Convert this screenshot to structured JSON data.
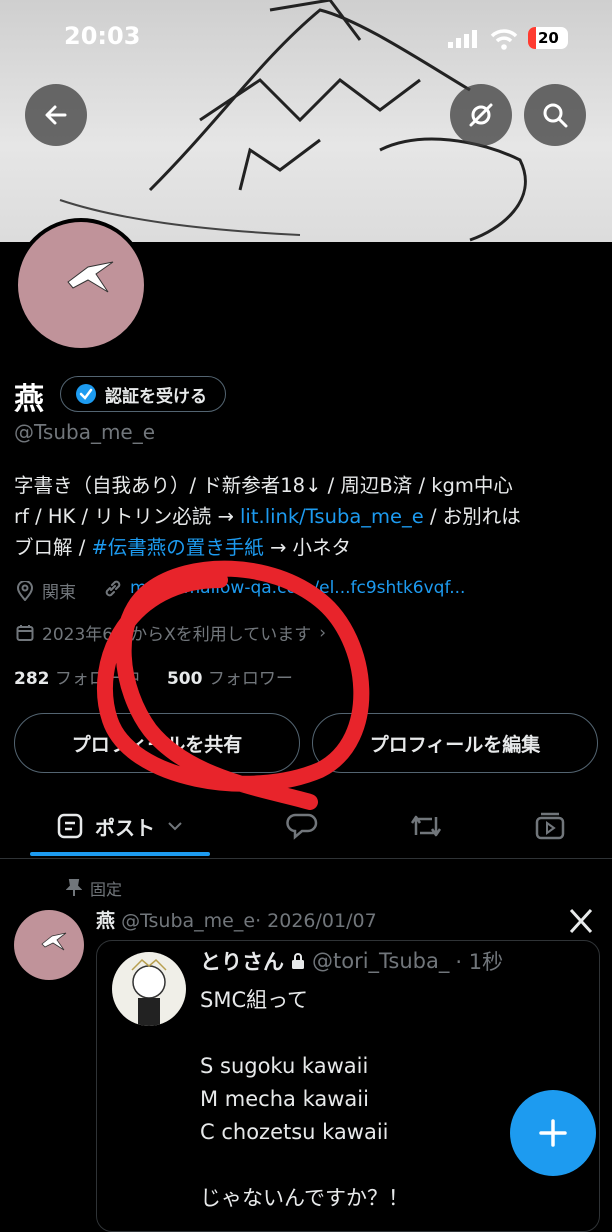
{
  "status_bar": {
    "time": "20:03",
    "battery": "20"
  },
  "profile": {
    "name": "燕",
    "verify_label": "認証を受ける",
    "handle": "@Tsuba_me_e",
    "bio_text_1": "字書き（自我あり）/ ド新参者18↓ / 周辺B済 / kgm中心",
    "bio_text_2": "rf / HK / リトリン必読 → ",
    "bio_link": "lit.link/Tsuba_me_e",
    "bio_text_3": " / お別れは",
    "bio_text_4": "ブロ解 / ",
    "bio_hashtag": "#伝書燕の置き手紙",
    "bio_text_5": " → 小ネタ",
    "location": "関東",
    "website": "marshmallow-qa.com/el...fc9shtk6vqf...",
    "joined": "2023年6月からXを利用しています",
    "following_count": "282",
    "following_label": "フォロー中",
    "followers_count": "500",
    "followers_label": "フォロワー",
    "share_button": "プロフィールを共有",
    "edit_button": "プロフィールを編集"
  },
  "tabs": {
    "posts_label": "ポスト"
  },
  "pinned_tweet": {
    "pinned_label": "固定",
    "author_name": "燕",
    "author_handle": "@Tsuba_me_e",
    "date": "· 2026/01/07",
    "quote": {
      "author_name": "とりさん",
      "author_handle": "@tori_Tsuba_",
      "time": "· 1秒",
      "body": "SMC組って\n\nS sugoku kawaii\nM mecha kawaii\nC chozetsu kawaii\n\nじゃないんですか？！"
    }
  },
  "colors": {
    "accent": "#1d9bf0",
    "annotation": "#e8242b",
    "avatar": "#c0939a"
  },
  "icons": [
    "back-arrow-icon",
    "no-notify-icon",
    "search-icon",
    "verified-badge-icon",
    "location-icon",
    "link-icon",
    "calendar-icon",
    "post-icon",
    "chevron-down-icon",
    "reply-icon",
    "repost-icon",
    "media-icon",
    "pin-icon",
    "x-logo-icon",
    "lock-icon",
    "plus-icon"
  ]
}
